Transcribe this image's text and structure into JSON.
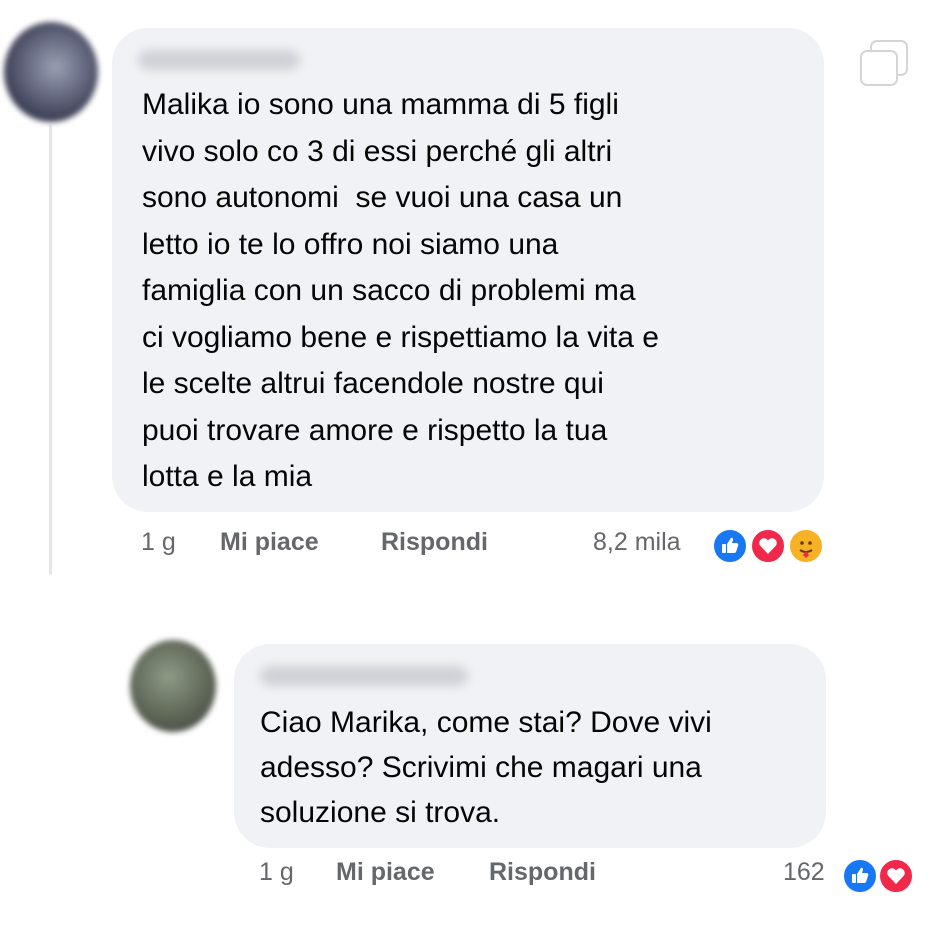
{
  "comments": [
    {
      "text": "Malika io sono una mamma di 5 figli\nvivo solo co 3 di essi perché gli altri\nsono autonomi  se vuoi una casa un\nletto io te lo offro noi siamo una\nfamiglia con un sacco di problemi ma\nci vogliamo bene e rispettiamo la vita e\nle scelte altrui facendole nostre qui\npuoi trovare amore e rispetto la tua\nlotta e la mia",
      "time": "1 g",
      "like_label": "Mi piace",
      "reply_label": "Rispondi",
      "reaction_count": "8,2 mila",
      "reactions": [
        "like-icon",
        "love-icon",
        "care-icon"
      ]
    },
    {
      "text": "Ciao Marika, come stai? Dove vivi\nadesso? Scrivimi che magari una\nsoluzione si trova.",
      "time": "1 g",
      "like_label": "Mi piace",
      "reply_label": "Rispondi",
      "reaction_count": "162",
      "reactions": [
        "like-icon",
        "love-icon"
      ]
    }
  ],
  "colors": {
    "bubble": "#f0f2f5",
    "meta_text": "#65676b",
    "like": "#1877f2",
    "love": "#f0284a",
    "care": "#f7b125"
  }
}
